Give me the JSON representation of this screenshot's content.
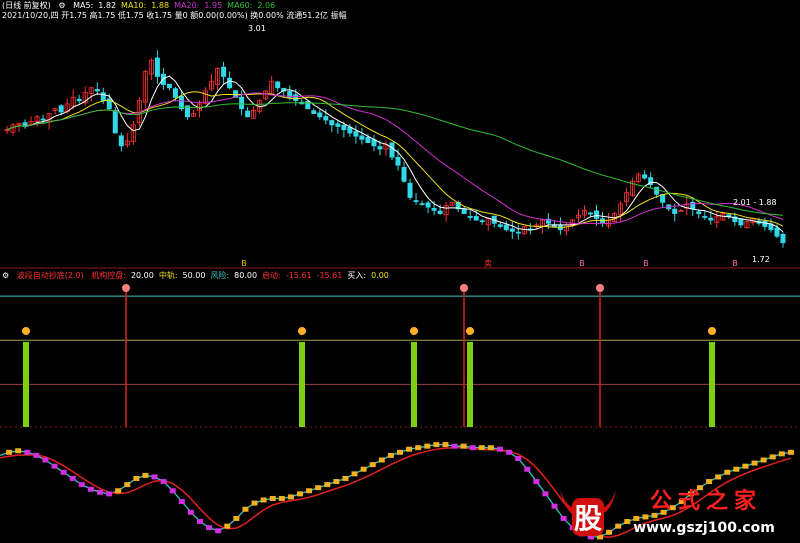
{
  "price_panel": {
    "name": "(日线 前复权)",
    "settings_icon": "gear-icon",
    "ma_labels": [
      {
        "label": "MA5:",
        "value": "1.82",
        "color": "#ffffff"
      },
      {
        "label": "MA10:",
        "value": "1.88",
        "color": "#f0e020"
      },
      {
        "label": "MA20:",
        "value": "1.95",
        "color": "#d030d0"
      },
      {
        "label": "MA60:",
        "value": "2.06",
        "color": "#30c030"
      }
    ],
    "info_line": "2021/10/20,四 开1.75 高1.75 低1.75 收1.75 量0 额0.00(0.00%) 换0.00% 流通51.2亿 振幅",
    "high_label": "3.01",
    "right_label": "2.01 - 1.88",
    "low_label": "1.72",
    "signals": [
      {
        "text": "B",
        "color": "#e0c000"
      },
      {
        "text": "卖",
        "color": "#ff3030"
      },
      {
        "text": "B",
        "color": "#ff60c0"
      },
      {
        "text": "B",
        "color": "#ff60c0"
      },
      {
        "text": "B",
        "color": "#ff60c0"
      }
    ]
  },
  "indicator_panel": {
    "title": "波段自动抄底(2.0)",
    "legend": [
      {
        "text": "机构控盘:",
        "color": "#ff3030"
      },
      {
        "text": "20.00",
        "color": "#ffffff"
      },
      {
        "text": "中轨:",
        "color": "#f0e020"
      },
      {
        "text": "50.00",
        "color": "#ffffff"
      },
      {
        "text": "风险:",
        "color": "#3fc8c8"
      },
      {
        "text": "80.00",
        "color": "#ffffff"
      },
      {
        "text": "启动:",
        "color": "#ff3030"
      },
      {
        "text": "-15.61",
        "color": "#ff3030"
      },
      {
        "text": "-15.61",
        "color": "#ff3030"
      },
      {
        "text": "买入:",
        "color": "#ffffff"
      },
      {
        "text": "0.00",
        "color": "#f0e020"
      }
    ],
    "level_lines": [
      80,
      50,
      20
    ],
    "level_colors": [
      "#3fc8c8",
      "#a0a040",
      "#a04040"
    ]
  },
  "watermark": {
    "logo_char": "股",
    "title": "公式之家",
    "url": "www.gszj100.com"
  },
  "chart_data": {
    "type": "candlestick",
    "n": 130,
    "y_range": [
      1.6,
      3.1
    ],
    "close": [
      2.42,
      2.45,
      2.46,
      2.44,
      2.47,
      2.5,
      2.48,
      2.52,
      2.55,
      2.53,
      2.58,
      2.62,
      2.6,
      2.65,
      2.68,
      2.66,
      2.6,
      2.55,
      2.4,
      2.32,
      2.35,
      2.45,
      2.6,
      2.78,
      2.85,
      2.75,
      2.7,
      2.68,
      2.62,
      2.55,
      2.5,
      2.52,
      2.58,
      2.66,
      2.72,
      2.8,
      2.75,
      2.68,
      2.62,
      2.55,
      2.5,
      2.54,
      2.6,
      2.66,
      2.72,
      2.68,
      2.66,
      2.62,
      2.6,
      2.58,
      2.55,
      2.52,
      2.5,
      2.48,
      2.45,
      2.44,
      2.42,
      2.4,
      2.38,
      2.36,
      2.34,
      2.32,
      2.3,
      2.33,
      2.25,
      2.2,
      2.1,
      2.0,
      1.98,
      1.96,
      1.94,
      1.92,
      1.9,
      1.95,
      1.97,
      1.93,
      1.9,
      1.88,
      1.86,
      1.85,
      1.87,
      1.84,
      1.82,
      1.8,
      1.79,
      1.78,
      1.82,
      1.8,
      1.83,
      1.86,
      1.84,
      1.82,
      1.8,
      1.83,
      1.86,
      1.89,
      1.92,
      1.9,
      1.87,
      1.84,
      1.86,
      1.9,
      1.96,
      2.03,
      2.1,
      2.14,
      2.12,
      2.08,
      2.02,
      1.97,
      1.93,
      1.9,
      1.92,
      1.96,
      1.93,
      1.9,
      1.88,
      1.86,
      1.88,
      1.9,
      1.88,
      1.85,
      1.83,
      1.85,
      1.87,
      1.84,
      1.82,
      1.8,
      1.76,
      1.72
    ],
    "signal_bars": [
      {
        "index": 4,
        "type": "buy"
      },
      {
        "index": 25,
        "type": "sell"
      },
      {
        "index": 60,
        "type": "buy"
      },
      {
        "index": 82,
        "type": "buy"
      },
      {
        "index": 92,
        "type": "sell"
      },
      {
        "index": 93,
        "type": "buy"
      },
      {
        "index": 120,
        "type": "sell"
      },
      {
        "index": 142,
        "type": "buy"
      }
    ],
    "oscillator": [
      55,
      57,
      58,
      57,
      55,
      52,
      48,
      44,
      40,
      36,
      33,
      31,
      30,
      32,
      36,
      40,
      42,
      41,
      38,
      32,
      25,
      18,
      12,
      8,
      6,
      9,
      14,
      20,
      24,
      26,
      27,
      27,
      28,
      30,
      32,
      34,
      36,
      38,
      40,
      43,
      46,
      49,
      52,
      55,
      57,
      59,
      60,
      61,
      62,
      62,
      61,
      61,
      60,
      60,
      60,
      59,
      57,
      53,
      46,
      38,
      30,
      22,
      14,
      8,
      4,
      2,
      2,
      5,
      9,
      12,
      14,
      15,
      16,
      18,
      21,
      25,
      30,
      34,
      38,
      41,
      44,
      46,
      48,
      50,
      52,
      54,
      56,
      57
    ]
  }
}
